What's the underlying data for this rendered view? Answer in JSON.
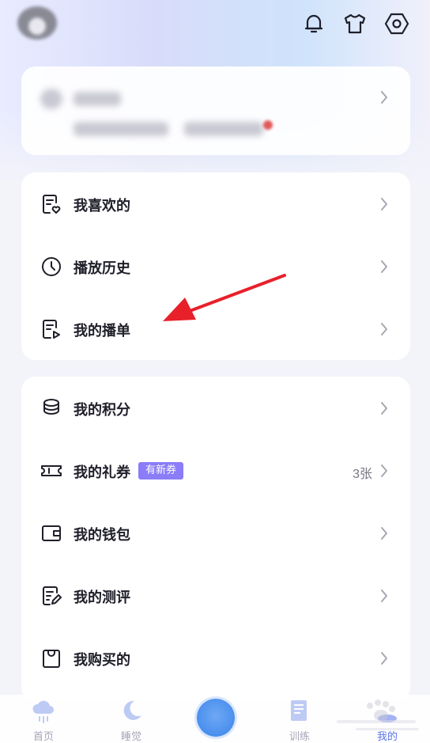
{
  "header": {
    "avatar_icon": "avatar",
    "icons": [
      "bell-icon",
      "tshirt-icon",
      "settings-icon"
    ]
  },
  "menu_group_1": {
    "items": [
      {
        "label": "我喜欢的",
        "icon": "favorites-list-icon"
      },
      {
        "label": "播放历史",
        "icon": "clock-icon"
      },
      {
        "label": "我的播单",
        "icon": "playlist-icon"
      }
    ]
  },
  "menu_group_2": {
    "items": [
      {
        "label": "我的积分",
        "icon": "coins-icon"
      },
      {
        "label": "我的礼券",
        "icon": "ticket-icon",
        "badge": "有新券",
        "count": "3张"
      },
      {
        "label": "我的钱包",
        "icon": "wallet-icon"
      },
      {
        "label": "我的测评",
        "icon": "assessment-icon"
      },
      {
        "label": "我购买的",
        "icon": "shopping-bag-icon"
      }
    ]
  },
  "tabbar": {
    "tabs": [
      {
        "label": "首页",
        "icon": "cloud-rain-icon"
      },
      {
        "label": "睡觉",
        "icon": "moon-icon"
      },
      {
        "label": "",
        "icon": "play-orb-icon"
      },
      {
        "label": "训练",
        "icon": "notebook-icon"
      },
      {
        "label": "我的",
        "icon": "profile-icon",
        "active": true
      }
    ]
  },
  "colors": {
    "accent": "#5b73e8",
    "badge": "#8b7cf7",
    "annotation_arrow": "#e8202a"
  }
}
